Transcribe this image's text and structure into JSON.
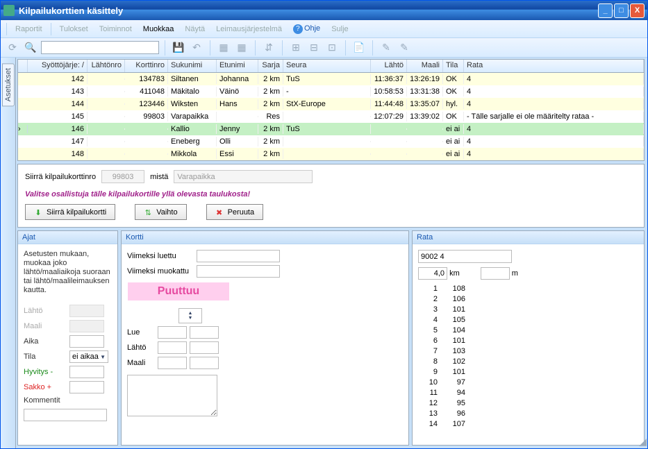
{
  "window": {
    "title": "Kilpailukorttien käsittely"
  },
  "menu": {
    "raportit": "Raportit",
    "tulokset": "Tulokset",
    "toiminnot": "Toiminnot",
    "muokkaa": "Muokkaa",
    "nayta": "Näytä",
    "leimaus": "Leimausjärjestelmä",
    "ohje": "Ohje",
    "sulje": "Sulje"
  },
  "sidetab": "Asetukset",
  "grid": {
    "cols": {
      "syotto": "Syöttöjärje:",
      "lahtonro": "Lähtönro",
      "korttinro": "Korttinro",
      "sukunimi": "Sukunimi",
      "etunimi": "Etunimi",
      "sarja": "Sarja",
      "seura": "Seura",
      "lahto": "Lähtö",
      "maali": "Maali",
      "tila": "Tila",
      "rata": "Rata"
    },
    "rows": [
      {
        "syo": "142",
        "kor": "134783",
        "suk": "Siltanen",
        "etu": "Johanna",
        "sar": "2 km",
        "seu": "TuS",
        "la": "11:36:37",
        "ma": "13:26:19",
        "ti": "OK",
        "ra": "4"
      },
      {
        "syo": "143",
        "kor": "411048",
        "suk": "Mäkitalo",
        "etu": "Väinö",
        "sar": "2 km",
        "seu": "-",
        "la": "10:58:53",
        "ma": "13:31:38",
        "ti": "OK",
        "ra": "4"
      },
      {
        "syo": "144",
        "kor": "123446",
        "suk": "Wiksten",
        "etu": "Hans",
        "sar": "2 km",
        "seu": "StX-Europe",
        "la": "11:44:48",
        "ma": "13:35:07",
        "ti": "hyl.",
        "ra": "4"
      },
      {
        "syo": "145",
        "kor": "99803",
        "suk": "Varapaikka",
        "etu": "",
        "sar": "Res",
        "seu": "",
        "la": "12:07:29",
        "ma": "13:39:02",
        "ti": "OK",
        "ra": " - Tälle sarjalle ei ole määritelty rataa -"
      },
      {
        "syo": "146",
        "kor": "",
        "suk": "Kallio",
        "etu": "Jenny",
        "sar": "2 km",
        "seu": "TuS",
        "la": "",
        "ma": "",
        "ti": "ei ai",
        "ra": "4",
        "sel": true
      },
      {
        "syo": "147",
        "kor": "",
        "suk": "Eneberg",
        "etu": "Olli",
        "sar": "2 km",
        "seu": "",
        "la": "",
        "ma": "",
        "ti": "ei ai",
        "ra": "4"
      },
      {
        "syo": "148",
        "kor": "",
        "suk": "Mikkola",
        "etu": "Essi",
        "sar": "2 km",
        "seu": "",
        "la": "",
        "ma": "",
        "ti": "ei ai",
        "ra": "4"
      }
    ]
  },
  "transfer": {
    "label": "Siirrä kilpailukorttinro",
    "nro": "99803",
    "mista_lbl": "mistä",
    "mista": "Varapaikka",
    "msg": "Valitse osallistuja tälle kilpailukortille yllä olevasta taulukosta!",
    "btn_siirra": "Siirrä kilpailukortti",
    "btn_vaihto": "Vaihto",
    "btn_peruuta": "Peruuta"
  },
  "ajat": {
    "title": "Ajat",
    "help": "Asetusten mukaan, muokaa joko lähtö/maaliaikoja suoraan tai lähtö/maalileimauksen kautta.",
    "lahto": "Lähtö",
    "maali": "Maali",
    "aika": "Aika",
    "tila": "Tila",
    "tila_val": "ei aikaa",
    "hyvitys": "Hyvitys -",
    "sakko": "Sakko +",
    "kommentit": "Kommentit"
  },
  "kortti": {
    "title": "Kortti",
    "luettu": "Viimeksi luettu",
    "muokattu": "Viimeksi muokattu",
    "puuttuu": "Puuttuu",
    "lue": "Lue",
    "lahto": "Lähtö",
    "maali": "Maali"
  },
  "rata": {
    "title": "Rata",
    "name": "9002 4",
    "km": "4,0",
    "km_lbl": "km",
    "m_lbl": "m",
    "controls": [
      {
        "n": "1",
        "v": "108"
      },
      {
        "n": "2",
        "v": "106"
      },
      {
        "n": "3",
        "v": "101"
      },
      {
        "n": "4",
        "v": "105"
      },
      {
        "n": "5",
        "v": "104"
      },
      {
        "n": "6",
        "v": "101"
      },
      {
        "n": "7",
        "v": "103"
      },
      {
        "n": "8",
        "v": "102"
      },
      {
        "n": "9",
        "v": "101"
      },
      {
        "n": "10",
        "v": "97"
      },
      {
        "n": "11",
        "v": "94"
      },
      {
        "n": "12",
        "v": "95"
      },
      {
        "n": "13",
        "v": "96"
      },
      {
        "n": "14",
        "v": "107"
      }
    ]
  }
}
